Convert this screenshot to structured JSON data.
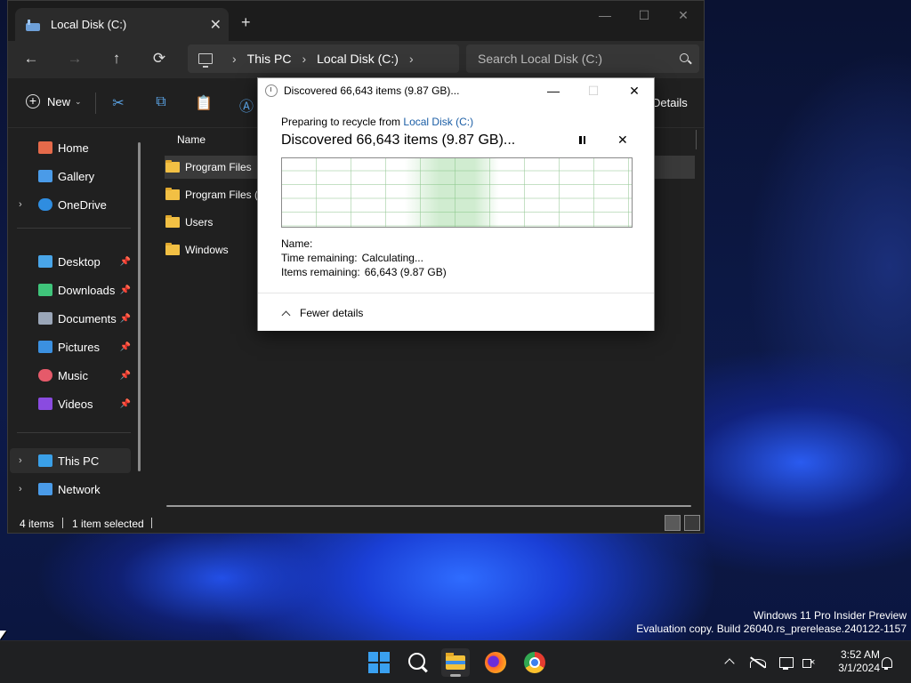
{
  "explorer": {
    "tab_title": "Local Disk (C:)",
    "tab_close": "✕",
    "new_tab": "+",
    "window_controls": {
      "minimize": "—",
      "maximize": "☐",
      "close": "✕"
    },
    "nav": {
      "back": "←",
      "forward": "→",
      "up": "↑",
      "refresh": "⟳"
    },
    "address": {
      "segment_1": "This PC",
      "segment_2": "Local Disk (C:)",
      "separator": "›"
    },
    "search_placeholder": "Search Local Disk (C:)",
    "toolbar": {
      "new_label": "New",
      "new_dropdown": "⌄",
      "cut": "✂",
      "copy": "⧉",
      "paste": "📋",
      "rename": "Ⓐ",
      "details_label": "Details"
    },
    "sidebar": {
      "items": [
        {
          "label": "Home",
          "icon": "home-icon",
          "color": "#e56a4a",
          "pinned": false
        },
        {
          "label": "Gallery",
          "icon": "gallery-icon",
          "color": "#4a9be8",
          "pinned": false
        },
        {
          "label": "OneDrive",
          "icon": "onedrive-icon",
          "color": "#2f8de0",
          "pinned": false
        },
        {
          "label": "Desktop",
          "icon": "desktop-icon",
          "color": "#49a5e8",
          "pinned": true
        },
        {
          "label": "Downloads",
          "icon": "downloads-icon",
          "color": "#3fc47a",
          "pinned": true
        },
        {
          "label": "Documents",
          "icon": "documents-icon",
          "color": "#9aa6b8",
          "pinned": true
        },
        {
          "label": "Pictures",
          "icon": "pictures-icon",
          "color": "#3b90e0",
          "pinned": true
        },
        {
          "label": "Music",
          "icon": "music-icon",
          "color": "#e55a6a",
          "pinned": true
        },
        {
          "label": "Videos",
          "icon": "videos-icon",
          "color": "#8a4be0",
          "pinned": true
        },
        {
          "label": "This PC",
          "icon": "this-pc-icon",
          "color": "#3aa0e8",
          "pinned": false
        },
        {
          "label": "Network",
          "icon": "network-icon",
          "color": "#4a9be8",
          "pinned": false
        }
      ],
      "pin_glyph": "📌",
      "expand_glyph": "›"
    },
    "content": {
      "column_name": "Name",
      "files": [
        "Program Files",
        "Program Files (x86)",
        "Users",
        "Windows"
      ],
      "selected_index": 0
    },
    "status": {
      "item_count": "4 items",
      "selection": "1 item selected"
    }
  },
  "dialog": {
    "title": "Discovered 66,643 items (9.87 GB)...",
    "window_controls": {
      "minimize": "—",
      "maximize": "☐",
      "close": "✕"
    },
    "preparing_prefix": "Preparing to recycle from ",
    "preparing_link": "Local Disk (C:)",
    "heading": "Discovered 66,643 items (9.87 GB)...",
    "cancel_glyph": "✕",
    "info": {
      "name_label": "Name:",
      "name_value": "",
      "time_label": "Time remaining:",
      "time_value": "Calculating...",
      "items_label": "Items remaining:",
      "items_value": "66,643 (9.87 GB)"
    },
    "footer_label": "Fewer details"
  },
  "watermark": {
    "line_1": "Windows 11 Pro Insider Preview",
    "line_2": "Evaluation copy. Build 26040.rs_prerelease.240122-1157"
  },
  "taskbar": {
    "time": "3:52 AM",
    "date": "3/1/2024"
  }
}
